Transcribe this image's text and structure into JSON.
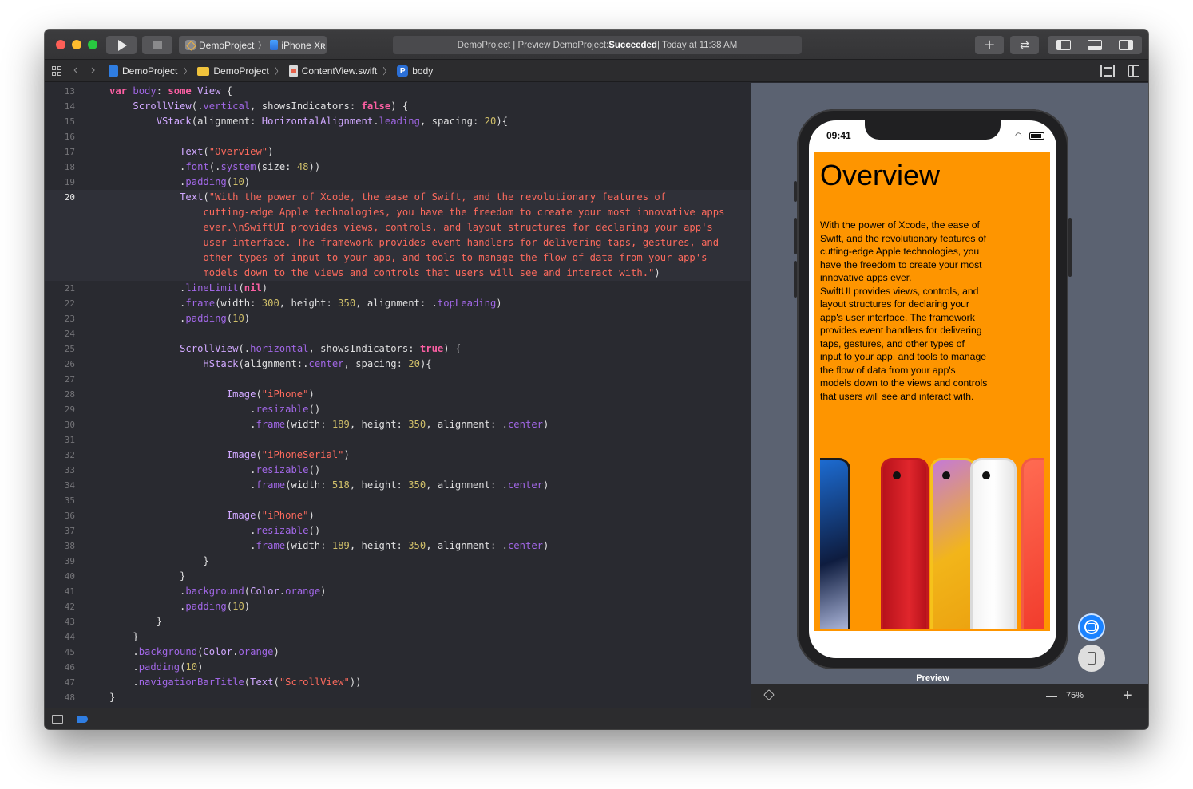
{
  "titlebar": {
    "scheme_project": "DemoProject",
    "scheme_device": "iPhone Xʀ",
    "activity_prefix": "DemoProject | Preview DemoProject: ",
    "activity_status": "Succeeded",
    "activity_suffix": " | Today at 11:38 AM"
  },
  "jumpbar": {
    "crumbs": [
      "DemoProject",
      "DemoProject",
      "ContentView.swift",
      "body"
    ]
  },
  "editor": {
    "current_line": 20,
    "lines": [
      {
        "n": "13",
        "html": "<span class=\"kw\">var</span> <span class=\"prop\">body</span>: <span class=\"kw\">some</span> <span class=\"ty\">View</span> {"
      },
      {
        "n": "14",
        "html": "    <span class=\"ty\">ScrollView</span>(.<span class=\"prop\">vertical</span>, showsIndicators: <span class=\"kw\">false</span>) {"
      },
      {
        "n": "15",
        "html": "        <span class=\"ty\">VStack</span>(alignment: <span class=\"ty\">HorizontalAlignment</span>.<span class=\"prop\">leading</span>, spacing: <span class=\"num\">20</span>){"
      },
      {
        "n": "16",
        "html": ""
      },
      {
        "n": "17",
        "html": "            <span class=\"ty\">Text</span>(<span class=\"str\">\"Overview\"</span>)"
      },
      {
        "n": "18",
        "html": "            .<span class=\"prop\">font</span>(.<span class=\"prop\">system</span>(size: <span class=\"num\">48</span>))"
      },
      {
        "n": "19",
        "html": "            .<span class=\"prop\">padding</span>(<span class=\"num\">10</span>)"
      },
      {
        "n": "20",
        "html": "            <span class=\"ty\">Text</span>(<span class=\"str\">\"With the power of Xcode, the ease of Swift, and the revolutionary features of</span>"
      },
      {
        "n": "",
        "html": "<span class=\"str\">                cutting-edge Apple technologies, you have the freedom to create your most innovative apps</span>"
      },
      {
        "n": "",
        "html": "<span class=\"str\">                ever.\\nSwiftUI provides views, controls, and layout structures for declaring your app's</span>"
      },
      {
        "n": "",
        "html": "<span class=\"str\">                user interface. The framework provides event handlers for delivering taps, gestures, and</span>"
      },
      {
        "n": "",
        "html": "<span class=\"str\">                other types of input to your app, and tools to manage the flow of data from your app's</span>"
      },
      {
        "n": "",
        "html": "<span class=\"str\">                models down to the views and controls that users will see and interact with.\"</span>)"
      },
      {
        "n": "21",
        "html": "            .<span class=\"prop\">lineLimit</span>(<span class=\"kw\">nil</span>)"
      },
      {
        "n": "22",
        "html": "            .<span class=\"prop\">frame</span>(width: <span class=\"num\">300</span>, height: <span class=\"num\">350</span>, alignment: .<span class=\"prop\">topLeading</span>)"
      },
      {
        "n": "23",
        "html": "            .<span class=\"prop\">padding</span>(<span class=\"num\">10</span>)"
      },
      {
        "n": "24",
        "html": ""
      },
      {
        "n": "25",
        "html": "            <span class=\"ty\">ScrollView</span>(.<span class=\"prop\">horizontal</span>, showsIndicators: <span class=\"kw\">true</span>) {"
      },
      {
        "n": "26",
        "html": "                <span class=\"ty\">HStack</span>(alignment:.<span class=\"prop\">center</span>, spacing: <span class=\"num\">20</span>){"
      },
      {
        "n": "27",
        "html": ""
      },
      {
        "n": "28",
        "html": "                    <span class=\"ty\">Image</span>(<span class=\"str\">\"iPhone\"</span>)"
      },
      {
        "n": "29",
        "html": "                        .<span class=\"prop\">resizable</span>()"
      },
      {
        "n": "30",
        "html": "                        .<span class=\"prop\">frame</span>(width: <span class=\"num\">189</span>, height: <span class=\"num\">350</span>, alignment: .<span class=\"prop\">center</span>)"
      },
      {
        "n": "31",
        "html": ""
      },
      {
        "n": "32",
        "html": "                    <span class=\"ty\">Image</span>(<span class=\"str\">\"iPhoneSerial\"</span>)"
      },
      {
        "n": "33",
        "html": "                        .<span class=\"prop\">resizable</span>()"
      },
      {
        "n": "34",
        "html": "                        .<span class=\"prop\">frame</span>(width: <span class=\"num\">518</span>, height: <span class=\"num\">350</span>, alignment: .<span class=\"prop\">center</span>)"
      },
      {
        "n": "35",
        "html": ""
      },
      {
        "n": "36",
        "html": "                    <span class=\"ty\">Image</span>(<span class=\"str\">\"iPhone\"</span>)"
      },
      {
        "n": "37",
        "html": "                        .<span class=\"prop\">resizable</span>()"
      },
      {
        "n": "38",
        "html": "                        .<span class=\"prop\">frame</span>(width: <span class=\"num\">189</span>, height: <span class=\"num\">350</span>, alignment: .<span class=\"prop\">center</span>)"
      },
      {
        "n": "39",
        "html": "                }"
      },
      {
        "n": "40",
        "html": "            }"
      },
      {
        "n": "41",
        "html": "            .<span class=\"prop\">background</span>(<span class=\"ty\">Color</span>.<span class=\"prop\">orange</span>)"
      },
      {
        "n": "42",
        "html": "            .<span class=\"prop\">padding</span>(<span class=\"num\">10</span>)"
      },
      {
        "n": "43",
        "html": "        }"
      },
      {
        "n": "44",
        "html": "    }"
      },
      {
        "n": "45",
        "html": "    .<span class=\"prop\">background</span>(<span class=\"ty\">Color</span>.<span class=\"prop\">orange</span>)"
      },
      {
        "n": "46",
        "html": "    .<span class=\"prop\">padding</span>(<span class=\"num\">10</span>)"
      },
      {
        "n": "47",
        "html": "    .<span class=\"prop\">navigationBarTitle</span>(<span class=\"ty\">Text</span>(<span class=\"str\">\"ScrollView\"</span>))"
      },
      {
        "n": "48",
        "html": "}"
      }
    ]
  },
  "preview": {
    "status_time": "09:41",
    "title": "Overview",
    "body": "With the power of Xcode, the ease of\nSwift, and the revolutionary features of\ncutting-edge Apple technologies, you\nhave the freedom to create your most\ninnovative apps ever.\nSwiftUI provides views, controls, and\nlayout structures for declaring your\napp's user interface. The framework\nprovides event handlers for delivering\ntaps, gestures, and other types of\ninput to your app, and tools to manage\nthe flow of data from your app's\nmodels down to the views and controls\nthat users will see and interact with.",
    "label": "Preview",
    "zoom": "75%"
  },
  "colors": {
    "preview_background": "#fe9500",
    "editor_background": "#292a30",
    "canvas_background": "#5b6271",
    "keyword": "#fc5fa3",
    "string": "#fc6a5d",
    "number": "#d0bf69"
  },
  "icons": [
    "play-icon",
    "stop-icon",
    "plus-icon",
    "swap-icon",
    "navigator-icon",
    "debug-area-icon",
    "inspector-icon",
    "grid-icon",
    "pin-icon",
    "live-preview-icon",
    "device-icon"
  ]
}
